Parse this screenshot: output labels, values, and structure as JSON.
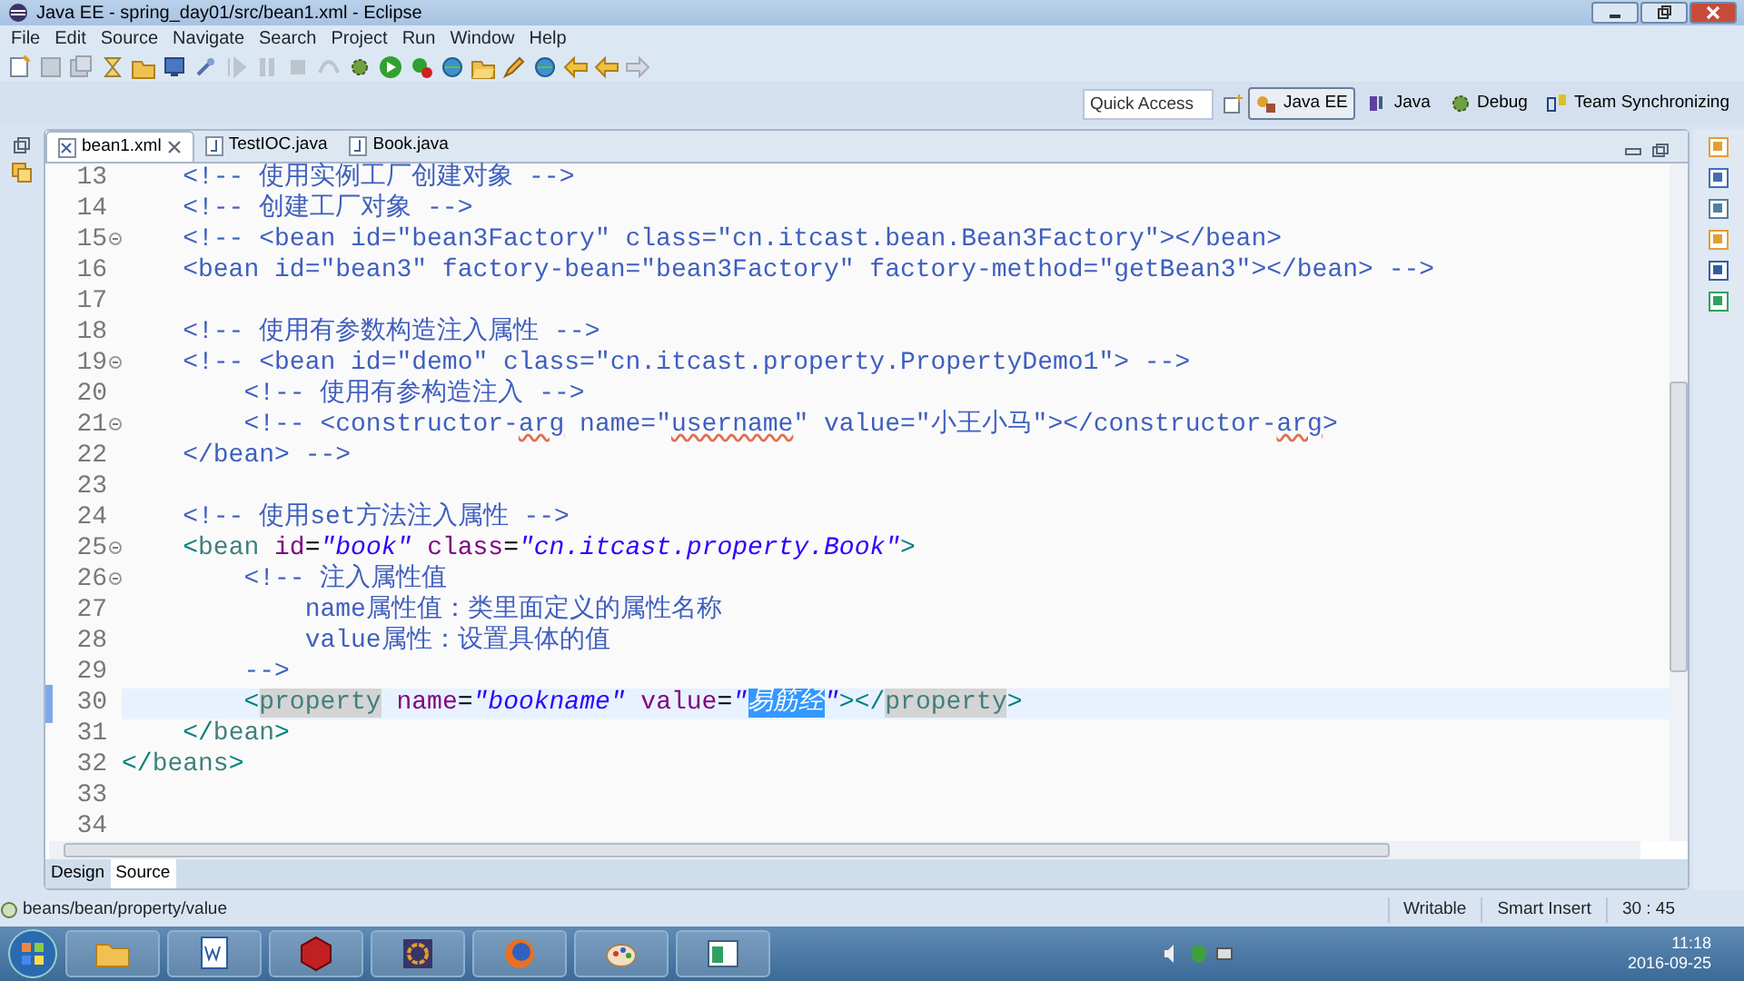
{
  "window": {
    "title": "Java EE - spring_day01/src/bean1.xml - Eclipse"
  },
  "menu": [
    "File",
    "Edit",
    "Source",
    "Navigate",
    "Search",
    "Project",
    "Run",
    "Window",
    "Help"
  ],
  "quick_access": {
    "placeholder": "Quick Access"
  },
  "perspectives": [
    {
      "label": "Java EE",
      "selected": true
    },
    {
      "label": "Java",
      "selected": false
    },
    {
      "label": "Debug",
      "selected": false
    },
    {
      "label": "Team Synchronizing",
      "selected": false
    }
  ],
  "editor_tabs": [
    {
      "label": "bean1.xml",
      "selected": true,
      "closable": true
    },
    {
      "label": "TestIOC.java",
      "selected": false,
      "closable": false
    },
    {
      "label": "Book.java",
      "selected": false,
      "closable": false
    }
  ],
  "lines": [
    {
      "number": "13",
      "fold": false,
      "current": false,
      "tokens": [
        {
          "t": "    <!-- 使用实例工厂创建对象 -->",
          "kind": "comment"
        }
      ]
    },
    {
      "number": "14",
      "fold": false,
      "current": false,
      "tokens": [
        {
          "t": "    <!-- 创建工厂对象 -->",
          "kind": "comment"
        }
      ]
    },
    {
      "number": "15",
      "fold": true,
      "current": false,
      "tokens": [
        {
          "t": "    <!-- <bean id=\"bean3Factory\" class=\"cn.itcast.bean.Bean3Factory\"></bean>",
          "kind": "comment"
        }
      ]
    },
    {
      "number": "16",
      "fold": false,
      "current": false,
      "tokens": [
        {
          "t": "    <bean id=\"bean3\" factory-bean=\"bean3Factory\" factory-method=\"getBean3\"></bean> -->",
          "kind": "comment"
        }
      ]
    },
    {
      "number": "17",
      "fold": false,
      "current": false
    },
    {
      "number": "18",
      "fold": false,
      "current": false,
      "tokens": [
        {
          "t": "    <!-- 使用有参数构造注入属性 -->",
          "kind": "comment"
        }
      ]
    },
    {
      "number": "19",
      "fold": true,
      "current": false,
      "tokens": [
        {
          "t": "    <!-- <bean id=\"demo\" class=\"cn.itcast.property.PropertyDemo1\"> -->",
          "kind": "comment"
        }
      ]
    },
    {
      "number": "20",
      "fold": false,
      "current": false,
      "tokens": [
        {
          "t": "        <!-- 使用有参构造注入 -->",
          "kind": "comment"
        }
      ]
    },
    {
      "number": "21",
      "fold": true,
      "current": false,
      "tokens": [
        {
          "t": "        <!-- <constructor-",
          "kind": "comment"
        },
        {
          "t": "arg",
          "kind": "comment",
          "misspelled": true
        },
        {
          "t": " name=\"",
          "kind": "comment"
        },
        {
          "t": "username",
          "kind": "comment",
          "misspelled": true
        },
        {
          "t": "\" value=\"小王小马\"></constructor-",
          "kind": "comment"
        },
        {
          "t": "arg",
          "kind": "comment",
          "misspelled": true
        },
        {
          "t": ">",
          "kind": "comment"
        }
      ]
    },
    {
      "number": "22",
      "fold": false,
      "current": false,
      "tokens": [
        {
          "t": "    </bean> -->",
          "kind": "comment"
        }
      ]
    },
    {
      "number": "23",
      "fold": false,
      "current": false
    },
    {
      "number": "24",
      "fold": false,
      "current": false,
      "tokens": [
        {
          "t": "    <!-- 使用set方法注入属性 -->",
          "kind": "comment"
        }
      ]
    },
    {
      "number": "25",
      "fold": true,
      "current": false,
      "tokens": [
        {
          "t": "    <",
          "kind": "bracket"
        },
        {
          "t": "bean",
          "kind": "tag"
        },
        {
          "t": " id",
          "kind": "attr"
        },
        {
          "t": "=",
          "kind": "text"
        },
        {
          "t": "\"book\"",
          "kind": "string"
        },
        {
          "t": " class",
          "kind": "attr"
        },
        {
          "t": "=",
          "kind": "text"
        },
        {
          "t": "\"cn.itcast.property.Book\"",
          "kind": "string"
        },
        {
          "t": ">",
          "kind": "bracket"
        }
      ]
    },
    {
      "number": "26",
      "fold": true,
      "current": false,
      "tokens": [
        {
          "t": "        <!-- 注入属性值",
          "kind": "comment"
        }
      ]
    },
    {
      "number": "27",
      "fold": false,
      "current": false,
      "tokens": [
        {
          "t": "            name属性值：类里面定义的属性名称",
          "kind": "comment"
        }
      ]
    },
    {
      "number": "28",
      "fold": false,
      "current": false,
      "tokens": [
        {
          "t": "            value属性：设置具体的值",
          "kind": "comment"
        }
      ]
    },
    {
      "number": "29",
      "fold": false,
      "current": false,
      "tokens": [
        {
          "t": "        -->",
          "kind": "comment"
        }
      ]
    },
    {
      "number": "30",
      "fold": false,
      "current": true,
      "tokens": [
        {
          "t": "        <",
          "kind": "bracket"
        },
        {
          "t": "property",
          "kind": "tag",
          "occurrence": true
        },
        {
          "t": " name",
          "kind": "attr"
        },
        {
          "t": "=",
          "kind": "text"
        },
        {
          "t": "\"bookname\"",
          "kind": "string"
        },
        {
          "t": " value",
          "kind": "attr"
        },
        {
          "t": "=",
          "kind": "text"
        },
        {
          "t": "\"",
          "kind": "string"
        },
        {
          "t": "易筋经",
          "kind": "string",
          "selected": true
        },
        {
          "t": "\"",
          "kind": "string"
        },
        {
          "t": "></",
          "kind": "bracket"
        },
        {
          "t": "property",
          "kind": "tag",
          "occurrence": true
        },
        {
          "t": ">",
          "kind": "bracket"
        }
      ]
    },
    {
      "number": "31",
      "fold": false,
      "current": false,
      "tokens": [
        {
          "t": "    </",
          "kind": "bracket"
        },
        {
          "t": "bean",
          "kind": "tag"
        },
        {
          "t": ">",
          "kind": "bracket"
        }
      ]
    },
    {
      "number": "32",
      "fold": false,
      "current": false,
      "tokens": [
        {
          "t": "</",
          "kind": "bracket"
        },
        {
          "t": "beans",
          "kind": "tag"
        },
        {
          "t": ">",
          "kind": "bracket"
        }
      ]
    },
    {
      "number": "33",
      "fold": false,
      "current": false
    },
    {
      "number": "34",
      "fold": false,
      "current": false
    }
  ],
  "view_tabs": [
    {
      "label": "Design",
      "selected": false
    },
    {
      "label": "Source",
      "selected": true
    }
  ],
  "status_bar": {
    "path": "beans/bean/property/value",
    "mode": "Writable",
    "insert": "Smart Insert",
    "position": "30 : 45"
  },
  "taskbar": {
    "time": "11:18",
    "date": "2016-09-25"
  }
}
